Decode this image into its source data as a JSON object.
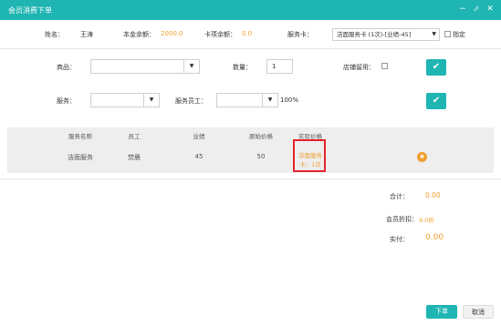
{
  "window": {
    "title": "会员消费下单",
    "controls": [
      "minimize",
      "maximize",
      "close"
    ]
  },
  "info": {
    "name_label": "姓名：",
    "name_value": "王涛",
    "balance_label": "本金余额：",
    "balance_value": "2000.0",
    "card_balance_label": "卡项余额：",
    "card_balance_value": "0.0",
    "service_card_label": "服务卡：",
    "service_card_value": "洁面服务卡 (1次)-[业绩-45]",
    "designate_label": "指定"
  },
  "form": {
    "product_label": "商品：",
    "product_value": "",
    "quantity_label": "数量：",
    "quantity_value": "1",
    "keep_in_store_label": "店铺留用：",
    "service_label": "服务：",
    "service_value": "",
    "staff_label": "服务员工：",
    "staff_value": "",
    "percent": "100%"
  },
  "table": {
    "headers": [
      "服务名称",
      "员工",
      "业绩",
      "原始价格",
      "实际价格"
    ],
    "rows": [
      {
        "service": "洁面服务",
        "staff": "焚晨",
        "performance": "45",
        "original_price": "50",
        "actual_price": "洁面服务卡：1次"
      }
    ]
  },
  "summary": {
    "total_label": "合计：",
    "total_value": "0.00",
    "discount_label": "会员折扣：",
    "discount_value": "9.0折",
    "actual_label": "实付：",
    "actual_value": "0.00"
  },
  "footer": {
    "submit_label": "下单",
    "cancel_label": "取消"
  },
  "colors": {
    "accent": "#1fb5b2",
    "highlight": "#f0a030",
    "alert_border": "#e3262a"
  }
}
